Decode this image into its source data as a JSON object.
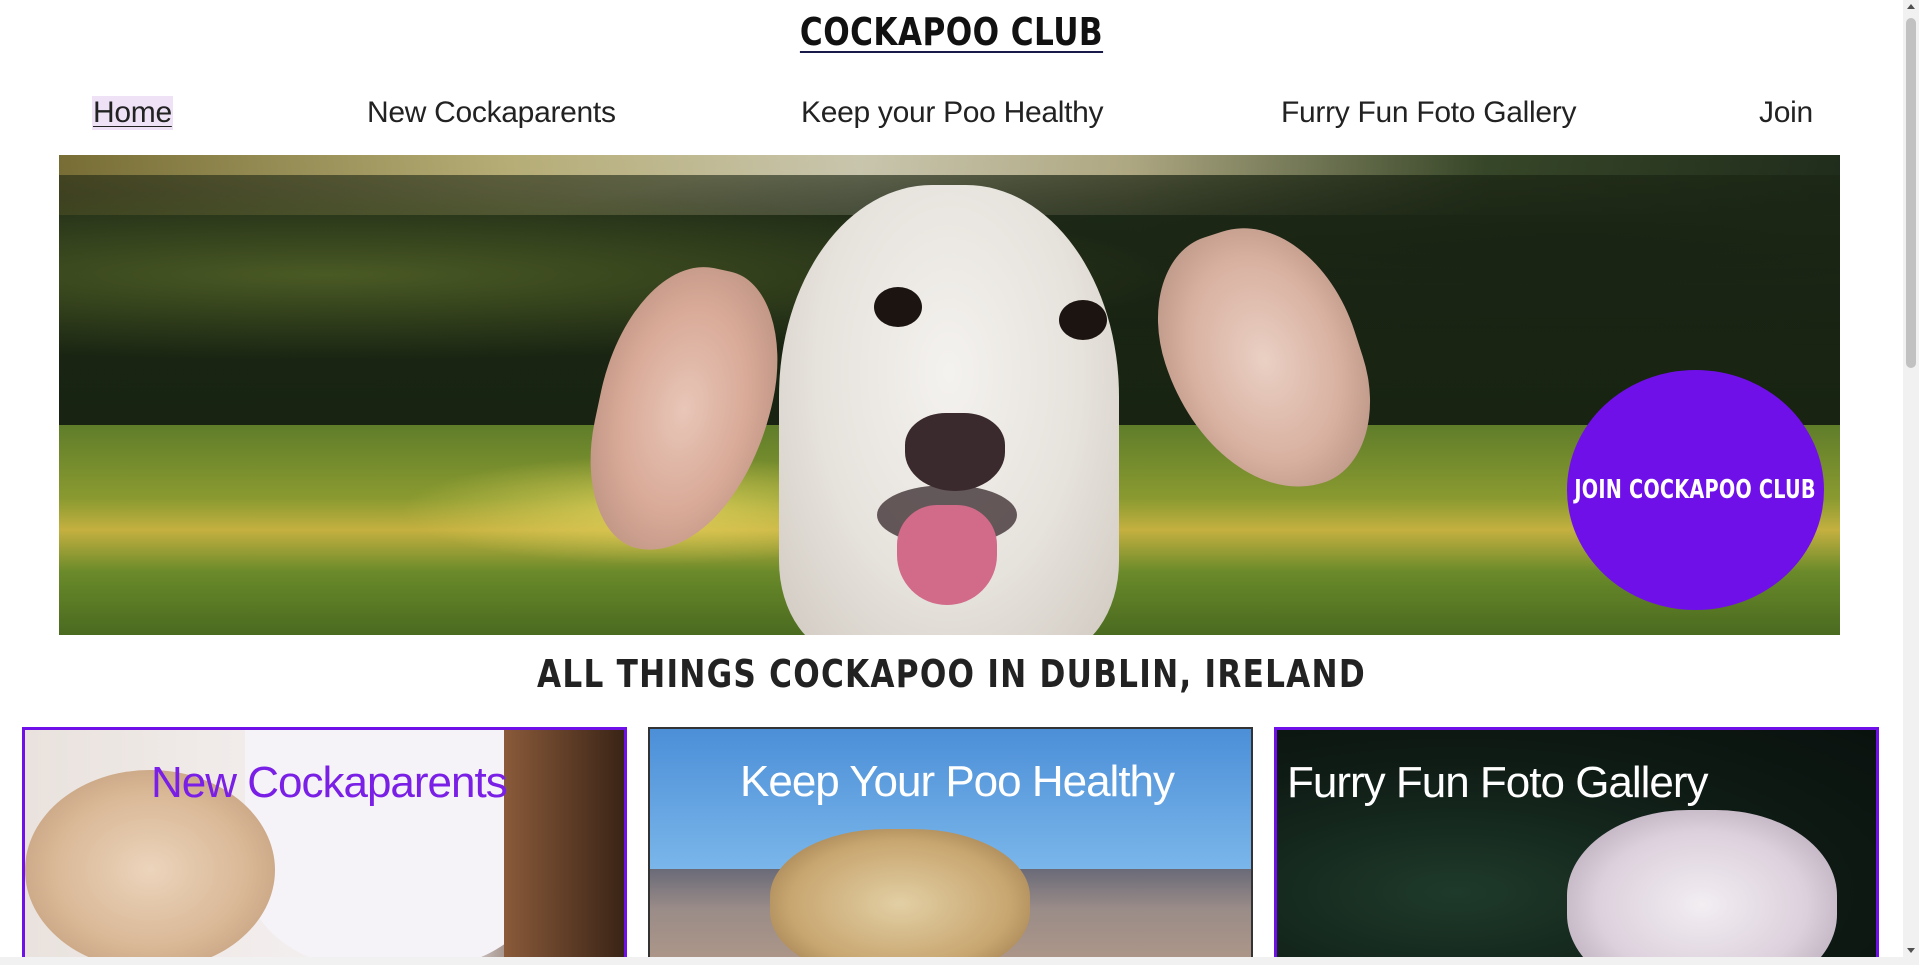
{
  "site": {
    "title": "COCKAPOO CLUB"
  },
  "nav": {
    "items": [
      {
        "label": "Home",
        "active": true
      },
      {
        "label": "New Cockaparents",
        "active": false
      },
      {
        "label": "Keep your Poo Healthy",
        "active": false
      },
      {
        "label": "Furry Fun Foto Gallery",
        "active": false
      },
      {
        "label": "Join",
        "active": false
      }
    ]
  },
  "hero": {
    "cta_label": "JOIN COCKAPOO CLUB"
  },
  "tagline": "ALL THINGS COCKAPOO IN DUBLIN, IRELAND",
  "cards": [
    {
      "caption": "New Cockaparents"
    },
    {
      "caption": "Keep Your Poo Healthy"
    },
    {
      "caption": "Furry Fun Foto Gallery"
    }
  ],
  "colors": {
    "accent": "#6f10e8",
    "nav_active_bg": "#efe2f7",
    "card1_caption": "#7a1fe6"
  }
}
